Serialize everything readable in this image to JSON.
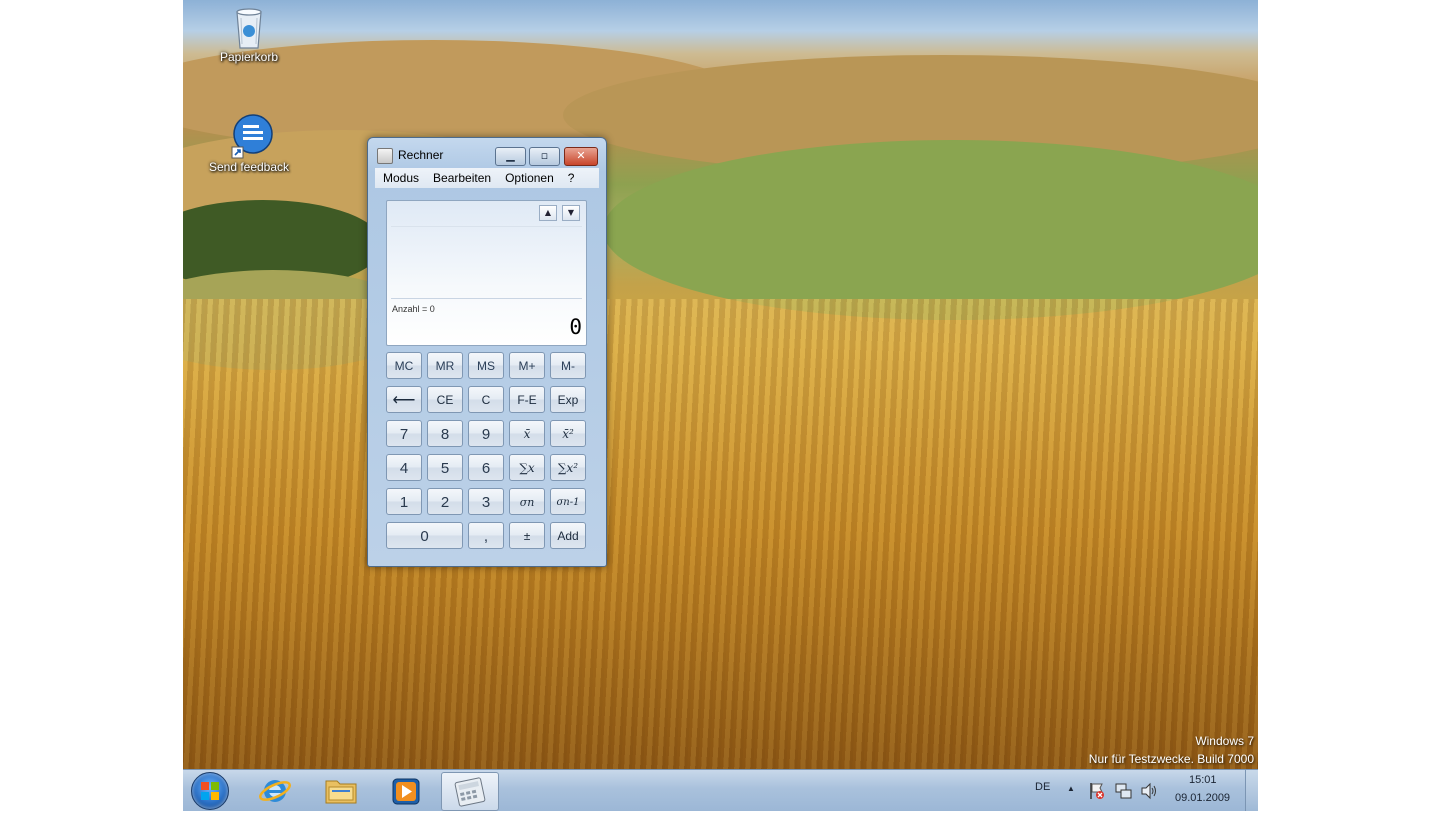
{
  "desktop": {
    "icons": [
      {
        "label": "Papierkorb",
        "icon": "recycle-bin-icon"
      },
      {
        "label": "Send feedback",
        "icon": "feedback-icon"
      }
    ],
    "watermark_line1": "Windows 7",
    "watermark_line2": "Nur für Testzwecke. Build 7000"
  },
  "calculator": {
    "title": "Rechner",
    "menu": [
      "Modus",
      "Bearbeiten",
      "Optionen",
      "?"
    ],
    "count_label": "Anzahl = 0",
    "display_value": "0",
    "history_up": "▲",
    "history_down": "▼",
    "keys": {
      "memory": [
        "MC",
        "MR",
        "MS",
        "M+",
        "M-"
      ],
      "row2": [
        "⟵",
        "CE",
        "C",
        "F-E",
        "Exp"
      ],
      "row3": [
        "7",
        "8",
        "9",
        "x̄",
        "x̄²"
      ],
      "row4": [
        "4",
        "5",
        "6",
        "∑x",
        "∑x²"
      ],
      "row5": [
        "1",
        "2",
        "3",
        "σn",
        "σn-1"
      ],
      "row6": [
        "0",
        ",",
        "±",
        "Add"
      ]
    }
  },
  "taskbar": {
    "language": "DE",
    "time": "15:01",
    "date": "09.01.2009",
    "tray_arrow": "▲",
    "apps": [
      "start-orb",
      "internet-explorer",
      "windows-explorer",
      "media-player",
      "calculator"
    ]
  }
}
